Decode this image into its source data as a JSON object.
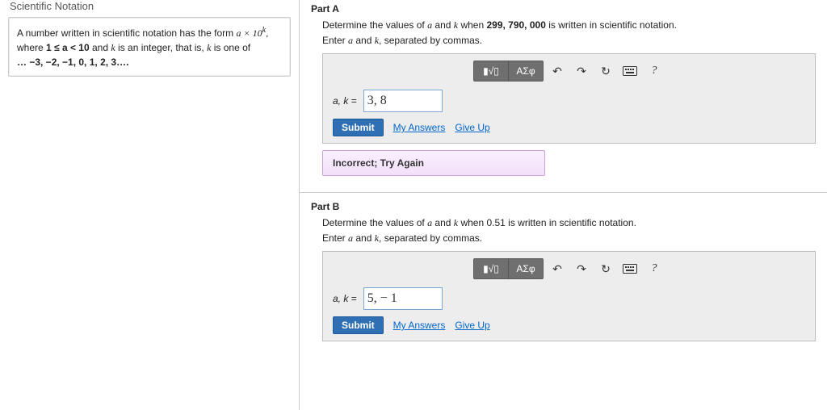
{
  "topic_title": "Scientific Notation",
  "intro": {
    "line1_pre": "A number written in scientific notation has the form ",
    "line1_expr": "a × 10",
    "line1_sup": "k",
    "line1_post": ",",
    "line2_pre": "where ",
    "line2_ineq": "1 ≤ a < 10",
    "line2_mid": " and ",
    "line2_k": "k",
    "line2_post": " is an integer, that is, ",
    "line2_k2": "k",
    "line2_end": " is one of",
    "line3": "… −3, −2, −1, 0, 1, 2, 3…."
  },
  "toolbar": {
    "template": "▮√▯",
    "greek": "ΑΣφ",
    "undo": "↶",
    "redo": "↷",
    "reset": "↻",
    "help": "?"
  },
  "actions": {
    "submit": "Submit",
    "my_answers": "My Answers",
    "give_up": "Give Up"
  },
  "partA": {
    "header": "Part A",
    "prompt_pre": "Determine the values of ",
    "a": "a",
    "and": " and ",
    "k": "k",
    "prompt_mid": " when ",
    "value": "299, 790, 000",
    "prompt_post": " is written in scientific notation.",
    "enter_pre": "Enter ",
    "enter_mid": " and ",
    "enter_post": ", separated by commas.",
    "input_label": "a, k = ",
    "input_value": "3, 8",
    "feedback": "Incorrect; Try Again"
  },
  "partB": {
    "header": "Part B",
    "prompt_pre": "Determine the values of ",
    "a": "a",
    "and": " and ",
    "k": "k",
    "prompt_mid": " when ",
    "value": "0.51",
    "prompt_post": " is written in scientific notation.",
    "enter_pre": "Enter ",
    "enter_mid": " and ",
    "enter_post": ", separated by commas.",
    "input_label": "a, k = ",
    "input_value": "5, − 1"
  }
}
